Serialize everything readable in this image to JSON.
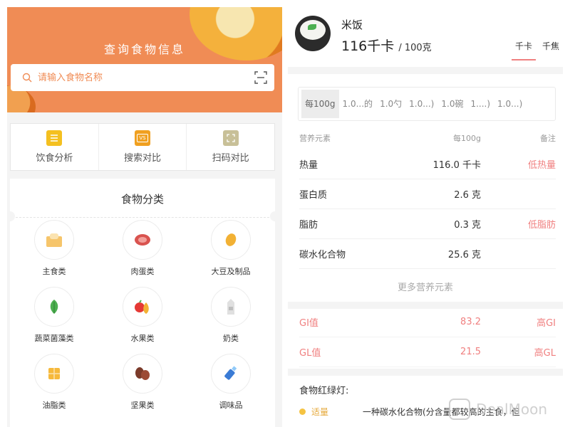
{
  "left": {
    "banner_title": "查询食物信息",
    "search": {
      "placeholder": "请输入食物名称"
    },
    "tools": [
      {
        "label": "饮食分析",
        "icon": "diet-analysis-icon",
        "color": "#f4c020"
      },
      {
        "label": "搜索对比",
        "icon": "search-compare-icon",
        "color": "#f0a020",
        "icon_text": "VS"
      },
      {
        "label": "扫码对比",
        "icon": "scan-compare-icon",
        "color": "#c8c098"
      }
    ],
    "categories_title": "食物分类",
    "categories": [
      {
        "label": "主食类",
        "icon": "staple-food-icon"
      },
      {
        "label": "肉蛋类",
        "icon": "meat-egg-icon"
      },
      {
        "label": "大豆及制品",
        "icon": "soybean-icon"
      },
      {
        "label": "蔬菜菌藻类",
        "icon": "vegetable-icon"
      },
      {
        "label": "水果类",
        "icon": "fruit-icon"
      },
      {
        "label": "奶类",
        "icon": "milk-icon"
      },
      {
        "label": "油脂类",
        "icon": "oil-fat-icon"
      },
      {
        "label": "坚果类",
        "icon": "nut-icon"
      },
      {
        "label": "调味品",
        "icon": "seasoning-icon"
      }
    ]
  },
  "right": {
    "food_name": "米饭",
    "calorie_value": "116千卡",
    "calorie_unit": "/ 100克",
    "unit_tabs": [
      "千卡",
      "千焦"
    ],
    "portions": [
      "每100g",
      "1.0...的",
      "1.0勺",
      "1.0...)",
      "1.0碗",
      "1....)",
      "1.0...)"
    ],
    "nutrient_header": {
      "name": "营养元素",
      "per": "每100g",
      "note": "备注"
    },
    "nutrients": [
      {
        "name": "热量",
        "value": "116.0 千卡",
        "note": "低热量"
      },
      {
        "name": "蛋白质",
        "value": "2.6 克",
        "note": ""
      },
      {
        "name": "脂肪",
        "value": "0.3 克",
        "note": "低脂肪"
      },
      {
        "name": "碳水化合物",
        "value": "25.6 克",
        "note": ""
      }
    ],
    "more_label": "更多营养元素",
    "gi": [
      {
        "name": "GI值",
        "value": "83.2",
        "note": "高GI"
      },
      {
        "name": "GL值",
        "value": "21.5",
        "note": "高GL"
      }
    ],
    "traffic_title": "食物红绿灯:",
    "traffic": {
      "tag": "适量",
      "text": "一种碳水化合物(分含量都较高的主食，但"
    },
    "watermark": "DealMoon",
    "accent": "#f08080",
    "banner_color": "#f08c55"
  }
}
